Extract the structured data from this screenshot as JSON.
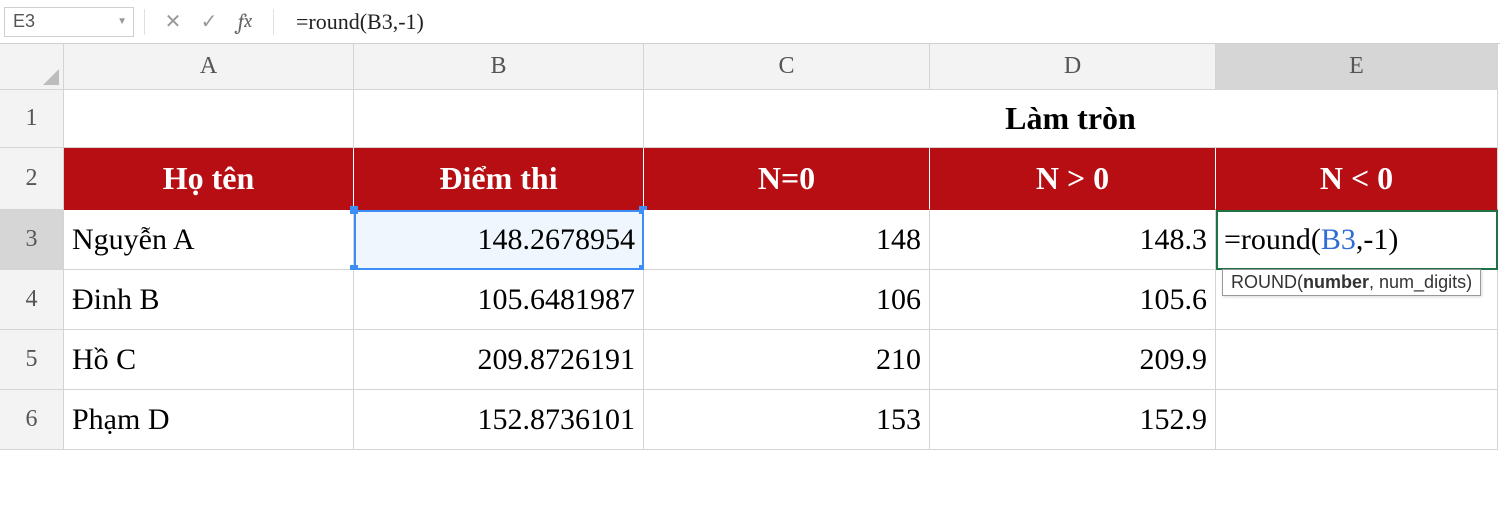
{
  "namebox": "E3",
  "formula_bar": "=round(B3,-1)",
  "col_headers": [
    "A",
    "B",
    "C",
    "D",
    "E"
  ],
  "row_headers": [
    "1",
    "2",
    "3",
    "4",
    "5",
    "6"
  ],
  "merged_title": "Làm tròn",
  "headers": {
    "A": "Họ tên",
    "B": "Điểm thi",
    "C": "N=0",
    "D": "N > 0",
    "E": "N < 0"
  },
  "rows": [
    {
      "A": "Nguyễn A",
      "B": "148.2678954",
      "C": "148",
      "D": "148.3",
      "E_prefix": "=round(",
      "E_ref": "B3",
      "E_suffix": ",-1)"
    },
    {
      "A": "Đinh B",
      "B": "105.6481987",
      "C": "106",
      "D": "105.6",
      "E": ""
    },
    {
      "A": "Hồ C",
      "B": "209.8726191",
      "C": "210",
      "D": "209.9",
      "E": ""
    },
    {
      "A": "Phạm D",
      "B": "152.8736101",
      "C": "153",
      "D": "152.9",
      "E": ""
    }
  ],
  "tooltip": {
    "fn": "ROUND",
    "arg1": "number",
    "arg2": "num_digits"
  }
}
